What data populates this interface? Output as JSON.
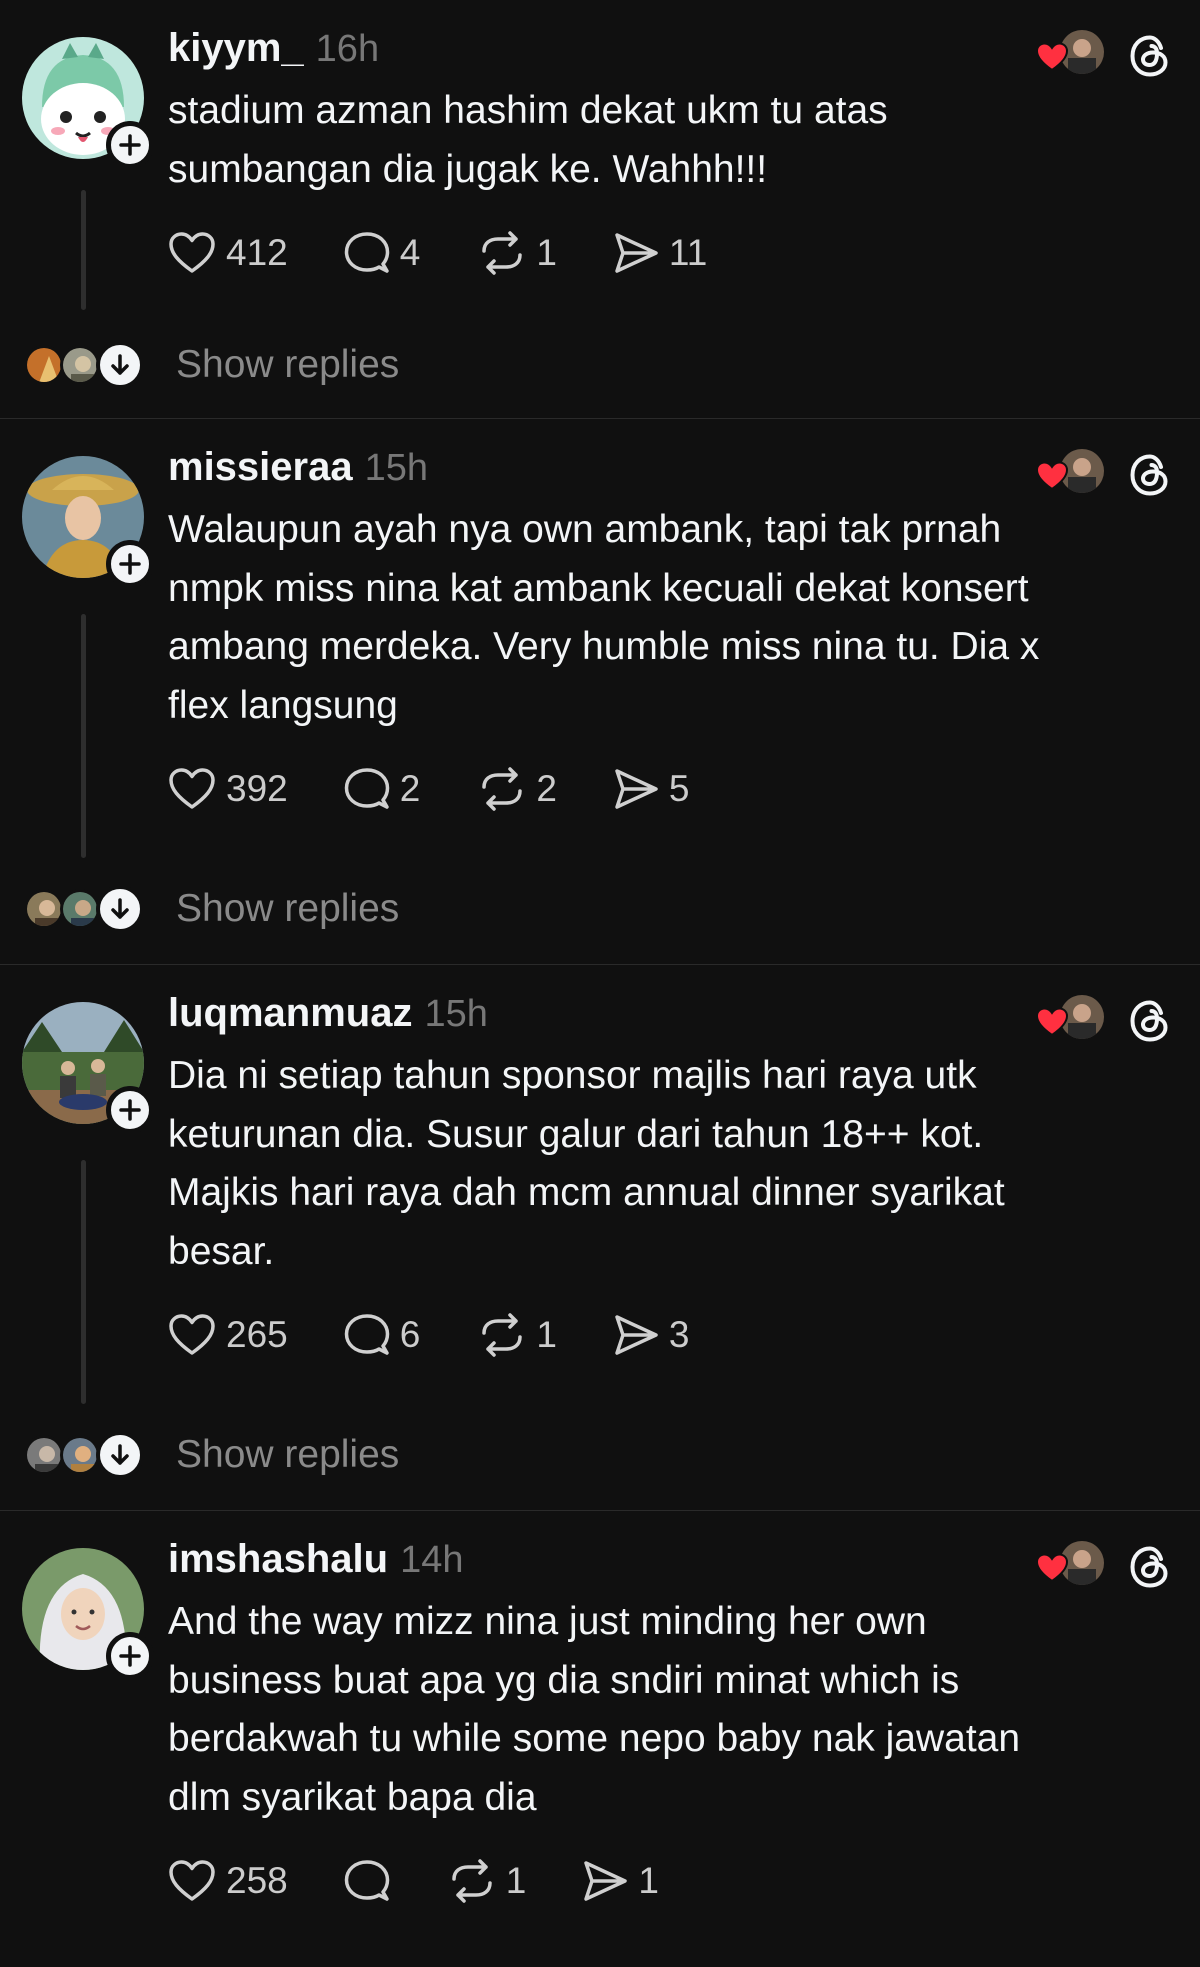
{
  "colors": {
    "background": "#101010",
    "text_primary": "#f3f5f7",
    "text_secondary": "#777777",
    "divider": "#2a2a2a",
    "heart_red": "#ff3040"
  },
  "posts": [
    {
      "username": "kiyym_",
      "time": "16h",
      "lines": [
        "stadium azman hashim dekat ukm tu atas",
        "sumbangan dia jugak ke. Wahhh!!!"
      ],
      "likes": "412",
      "replies": "4",
      "reposts": "1",
      "shares": "11",
      "show_replies": "Show replies"
    },
    {
      "username": "missieraa",
      "time": "15h",
      "lines": [
        "Walaupun ayah nya own ambank, tapi tak prnah",
        "nmpk miss nina kat ambank kecuali dekat konsert",
        "ambang merdeka. Very humble miss nina tu. Dia x",
        "flex langsung"
      ],
      "likes": "392",
      "replies": "2",
      "reposts": "2",
      "shares": "5",
      "show_replies": "Show replies"
    },
    {
      "username": "luqmanmuaz",
      "time": "15h",
      "lines": [
        "Dia ni setiap tahun sponsor majlis hari raya utk",
        "keturunan dia. Susur galur dari tahun 18++ kot.",
        "Majkis hari raya dah mcm annual dinner syarikat",
        "besar."
      ],
      "likes": "265",
      "replies": "6",
      "reposts": "1",
      "shares": "3",
      "show_replies": "Show replies"
    },
    {
      "username": "imshashalu",
      "time": "14h",
      "lines": [
        "And the way mizz nina just minding her own",
        "business buat apa yg dia sndiri minat which is",
        "berdakwah tu while some nepo baby nak jawatan",
        "dlm syarikat bapa dia"
      ],
      "likes": "258",
      "replies": "",
      "reposts": "1",
      "shares": "1",
      "show_replies": ""
    }
  ],
  "icons": {
    "like": "heart-outline-icon",
    "reply": "speech-bubble-icon",
    "repost": "repost-arrows-icon",
    "share": "send-paper-plane-icon",
    "follow": "plus-icon",
    "expand": "arrow-down-icon",
    "app": "threads-logo-icon",
    "liked_by_author": "red-heart-icon"
  }
}
